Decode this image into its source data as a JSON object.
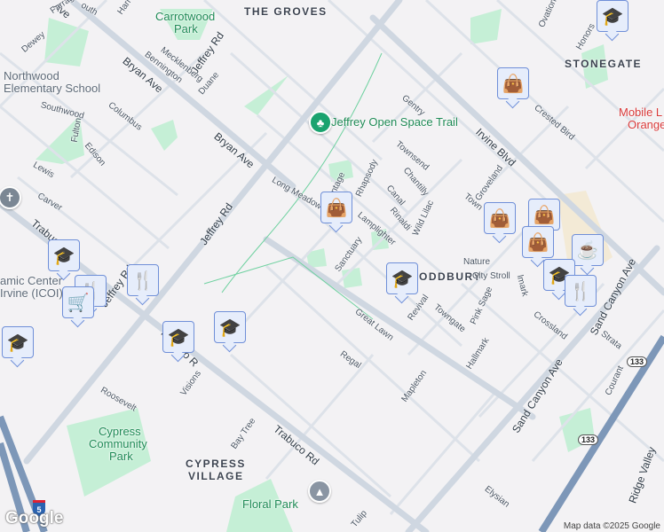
{
  "neighborhoods": {
    "groves": "THE GROVES",
    "stonegate": "STONEGATE",
    "woodbury": "ODDBURY",
    "cypress_village_1": "CYPRESS",
    "cypress_village_2": "VILLAGE"
  },
  "parks": {
    "carrotwood_1": "Carrotwood",
    "carrotwood_2": "Park",
    "cypress_1": "Cypress",
    "cypress_2": "Community",
    "cypress_3": "Park",
    "floral": "Floral Park",
    "trail": "Jeffrey Open Space Trail"
  },
  "pois": {
    "northwood_1": "Northwood",
    "northwood_2": "Elementary School",
    "icoi_1": "amic Center",
    "icoi_2": "Irvine (ICOI)",
    "mobile_1": "Mobile L",
    "mobile_2": "Orange"
  },
  "major_roads": {
    "jeffrey_1": "Jeffrey Rd",
    "jeffrey_2": "Jeffrey Rd",
    "jeffrey_3": "Jeffrey Rd",
    "bryan_1": "Bryan Ave",
    "bryan_2": "Bryan Ave",
    "bryan_3": "Ave",
    "irvine": "Irvine Blvd",
    "trabuco_1": "Trabuco Rd",
    "trabuco_2": "Trabuco R",
    "trabuco_3": "Trabuco Rd",
    "sand_canyon_1": "Sand Canyon Ave",
    "sand_canyon_2": "Sand Canyon Ave",
    "ridge_valley": "Ridge Valley"
  },
  "streets": [
    "Dewey",
    "Farragut",
    "Bennington",
    "Mecklenberg",
    "Duane",
    "Southwood",
    "Columbus",
    "Fulton",
    "Edison",
    "Lewis",
    "Carver",
    "Long Meadow",
    "Vintage",
    "Rhapsody",
    "Canal",
    "Rinaldi",
    "Lamplighter",
    "Wild Lilac",
    "Chantilly",
    "Townsend",
    "Gentry",
    "Groveland",
    "Crested Bird",
    "Sanctuary",
    "Nature",
    "City Stroll",
    "Great Lawn",
    "Revival",
    "Towngate",
    "Pink Sage",
    "Crossland",
    "Strata",
    "Hallmark",
    "Regal",
    "Mapleton",
    "Courant",
    "Elysian",
    "Tulip",
    "Bay Tree",
    "Visions",
    "Roosevelt",
    "Ovation",
    "Honors",
    "Harr",
    "outh",
    "lmark",
    "Town"
  ],
  "shields": {
    "sr133_1": "133",
    "sr133_2": "133",
    "i5": "5"
  },
  "markers": [
    {
      "icon": "graduation-cap"
    },
    {
      "icon": "shopping-bag"
    },
    {
      "icon": "shopping-bag"
    },
    {
      "icon": "shopping-bag"
    },
    {
      "icon": "shopping-bag"
    },
    {
      "icon": "shopping-bag"
    },
    {
      "icon": "coffee"
    },
    {
      "icon": "graduation-cap"
    },
    {
      "icon": "fork-knife"
    },
    {
      "icon": "graduation-cap"
    },
    {
      "icon": "graduation-cap"
    },
    {
      "icon": "fork-knife"
    },
    {
      "icon": "fork-knife"
    },
    {
      "icon": "shopping-cart"
    },
    {
      "icon": "graduation-cap"
    },
    {
      "icon": "graduation-cap"
    },
    {
      "icon": "graduation-cap"
    }
  ],
  "branding": {
    "logo": "Google",
    "attribution": "Map data ©2025 Google"
  },
  "colors": {
    "park": "#c5efd6",
    "road": "#d7dde5",
    "highway": "#7d97b8",
    "marker_bg": "#e6edfb",
    "marker_icon": "#0f3d63"
  }
}
